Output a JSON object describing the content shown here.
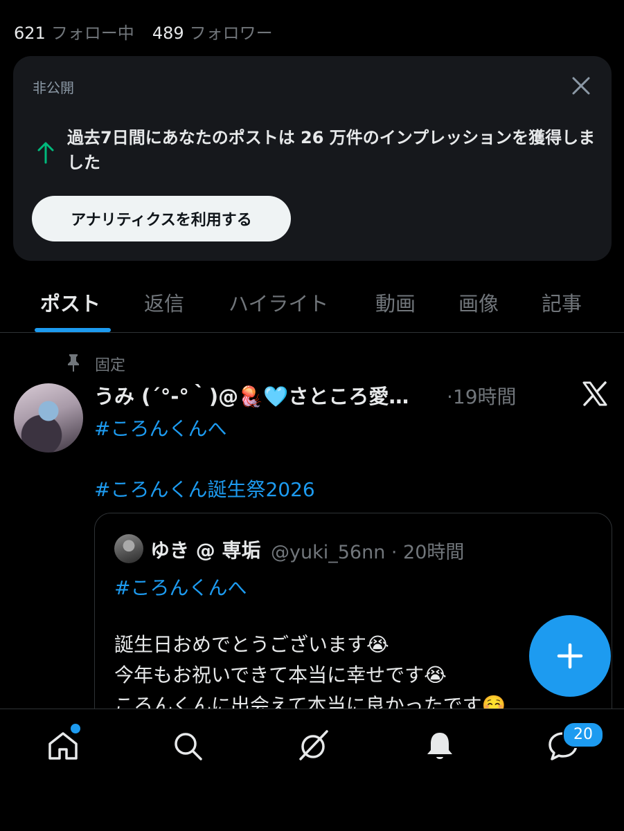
{
  "profile_stats": {
    "following_count": "621",
    "following_label": "フォロー中",
    "followers_count": "489",
    "followers_label": "フォロワー"
  },
  "private_card": {
    "label": "非公開",
    "message": "過去7日間にあなたのポストは 26 万件のインプレッションを獲得しました",
    "button_label": "アナリティクスを利用する"
  },
  "tabs": [
    {
      "label": "ポスト",
      "active": true
    },
    {
      "label": "返信"
    },
    {
      "label": "ハイライト"
    },
    {
      "label": "動画"
    },
    {
      "label": "画像"
    },
    {
      "label": "記事"
    }
  ],
  "pinned_post": {
    "pinned_label": "固定",
    "author_name": "うみ (´°-°｀)@🪼🩵さところ愛…",
    "time": "·19時間",
    "hashtags": [
      "#ころんくんへ",
      "#ころんくん誕生祭2026"
    ],
    "quoted": {
      "author_name": "ゆき @ 専垢",
      "handle_time": "@yuki_56nn · 20時間",
      "hashtag": "#ころんくんへ",
      "body": "誕生日おめでとうございます😭\n今年もお祝いできて本当に幸せです😭\nころんくんに出会えて本当に良かったです☺️"
    }
  },
  "bottom_nav": {
    "items": [
      "home-icon",
      "search-icon",
      "grok-icon",
      "notifications-icon",
      "messages-icon"
    ],
    "messages_badge": "20"
  },
  "colors": {
    "accent": "#1d9bf0",
    "background": "#000000",
    "card": "#16181c",
    "secondary_text": "#71767b",
    "up_arrow": "#00ba7c"
  }
}
